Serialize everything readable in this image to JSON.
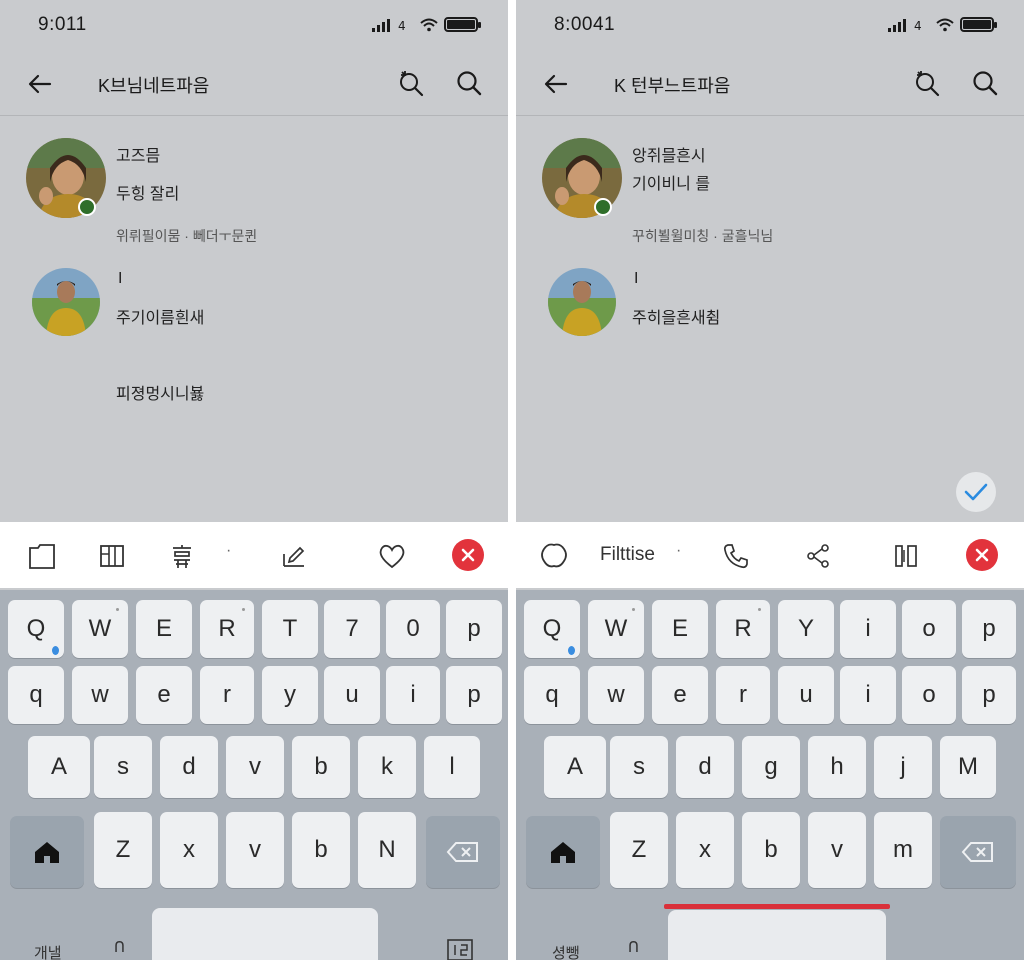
{
  "left": {
    "status": {
      "time": "9:011"
    },
    "appbar": {
      "title": "K브님네트파음"
    },
    "contacts": [
      {
        "name": "고즈믐",
        "line2": "두힝 잘리",
        "meta": "위뤼필이뭄 · 뻬더ㅜ문퀸"
      },
      {
        "name": "I",
        "line2": "주기이름흰새",
        "meta": ""
      }
    ],
    "extra_text": "피졍멍시니뵳",
    "toolbar": {
      "dot": "·"
    },
    "keyboard": {
      "row1": [
        "Q",
        "W",
        "E",
        "R",
        "T",
        "7",
        "0",
        "p"
      ],
      "row2": [
        "q",
        "w",
        "e",
        "r",
        "y",
        "u",
        "i",
        "p"
      ],
      "row3": [
        "A",
        "s",
        "d",
        "v",
        "b",
        "k",
        "l"
      ],
      "row4": [
        "Z",
        "x",
        "v",
        "b",
        "N"
      ],
      "foot_left": "개낼",
      "foot_mid": "ᑎ"
    }
  },
  "right": {
    "status": {
      "time": "8:0041"
    },
    "appbar": {
      "title": "K 턴부느트파음"
    },
    "contacts": [
      {
        "name": "앙쥐믈흔시",
        "line2": "기이비니 를",
        "meta": "꾸히뵐윌미칭 · 굴흘닉님"
      },
      {
        "name": "I",
        "line2": "주히을흔새췸",
        "meta": ""
      }
    ],
    "toolbar": {
      "label": "Filttise",
      "dot": "·"
    },
    "keyboard": {
      "row1": [
        "Q",
        "W",
        "E",
        "R",
        "Y",
        "i",
        "o",
        "p"
      ],
      "row2": [
        "q",
        "w",
        "e",
        "r",
        "u",
        "i",
        "o",
        "p"
      ],
      "row3": [
        "A",
        "s",
        "d",
        "g",
        "h",
        "j",
        "M"
      ],
      "row4": [
        "Z",
        "x",
        "b",
        "v",
        "m"
      ],
      "foot_left": "셩뺑",
      "foot_mid": "ᑎ"
    }
  },
  "colors": {
    "accent_close": "#e2333c",
    "check": "#2a8be0",
    "keyboard_bg": "#a9b0b8"
  }
}
